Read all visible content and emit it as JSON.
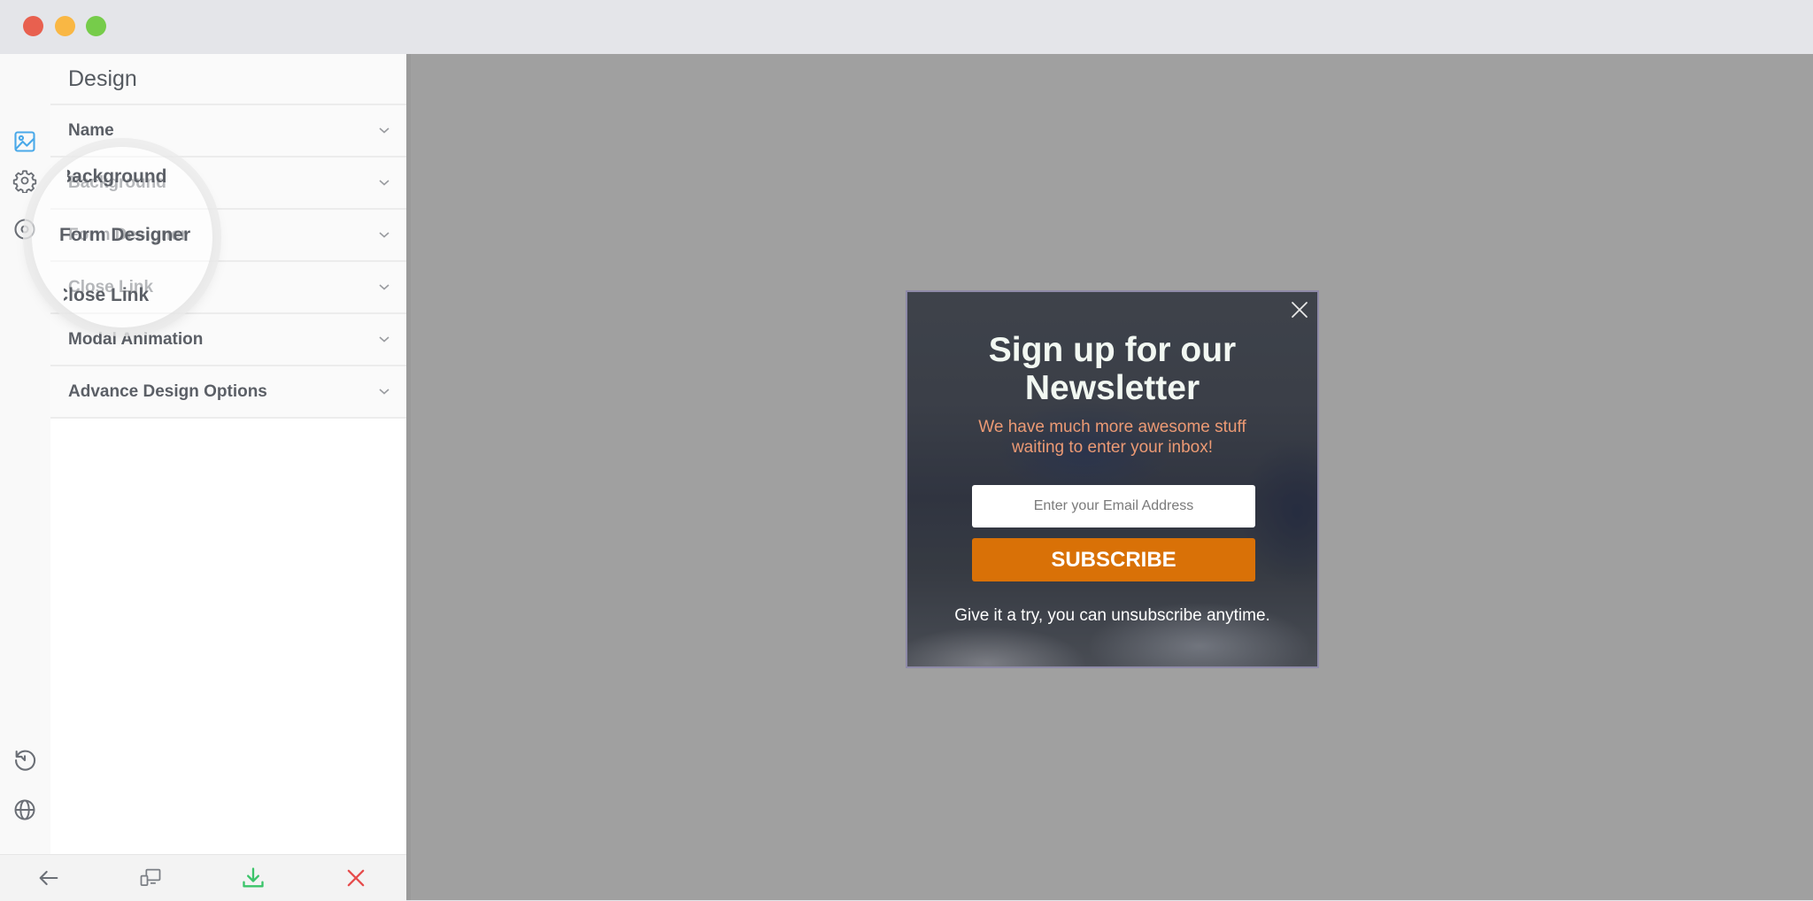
{
  "window": {
    "controls": [
      "close",
      "minimize",
      "maximize"
    ]
  },
  "rail": {
    "top_icons": [
      {
        "name": "image-icon",
        "active": true
      },
      {
        "name": "gear-icon",
        "active": false
      },
      {
        "name": "target-icon",
        "active": false
      }
    ],
    "bottom_icons": [
      {
        "name": "history-icon"
      },
      {
        "name": "globe-icon"
      }
    ]
  },
  "panel": {
    "title": "Design",
    "items": [
      {
        "label": "Name"
      },
      {
        "label": "Background"
      },
      {
        "label": "Form Designer"
      },
      {
        "label": "Close Link"
      },
      {
        "label": "Modal Animation"
      },
      {
        "label": "Advance Design Options"
      }
    ],
    "spotlight": {
      "labels": [
        "Background",
        "Form Designer",
        "Close Link"
      ]
    }
  },
  "bottombar": {
    "buttons": [
      {
        "name": "back-arrow-icon"
      },
      {
        "name": "responsive-devices-icon"
      },
      {
        "name": "download-icon"
      },
      {
        "name": "close-icon"
      }
    ]
  },
  "colors": {
    "accent_blue": "#4aa9e9",
    "download_green": "#3cc46a",
    "close_red": "#e64c4c",
    "subscribe_orange": "#d97107",
    "subtitle_salmon": "#ec9a74"
  },
  "popup": {
    "title": "Sign up for our Newsletter",
    "subtitle": "We have much more awesome stuff waiting to enter your inbox!",
    "email_placeholder": "Enter your Email Address",
    "email_value": "",
    "button_label": "SUBSCRIBE",
    "footer": "Give it a try, you can unsubscribe anytime."
  }
}
